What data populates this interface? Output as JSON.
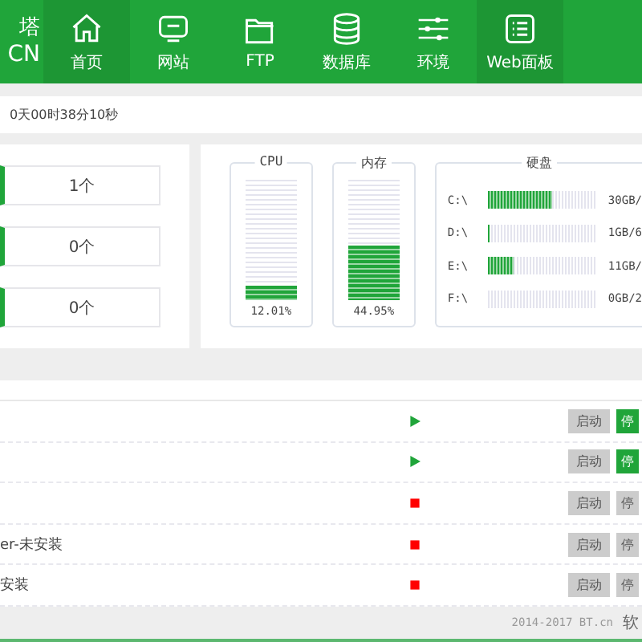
{
  "header": {
    "logo": {
      "line_1": "塔",
      "line_2": "CN"
    },
    "nav": [
      {
        "label": "首页",
        "selected": true
      },
      {
        "label": "网站",
        "selected": false
      },
      {
        "label": "FTP",
        "selected": false
      },
      {
        "label": "数据库",
        "selected": false
      },
      {
        "label": "环境",
        "selected": false
      },
      {
        "label": "Web面板",
        "selected": true
      }
    ]
  },
  "uptime": "0天00时38分10秒",
  "counts": [
    "1个",
    "0个",
    "0个"
  ],
  "gauges": [
    {
      "title": "CPU",
      "level": 0.1201,
      "reading": "12.01%"
    },
    {
      "title": "内存",
      "level": 0.4495,
      "reading": "44.95%"
    }
  ],
  "disk": {
    "title": "硬盘",
    "drives": [
      {
        "name": "C:\\",
        "level": 0.6,
        "reading": "30GB/"
      },
      {
        "name": "D:\\",
        "level": 0.02,
        "reading": "1GB/6"
      },
      {
        "name": "E:\\",
        "level": 0.24,
        "reading": "11GB/"
      },
      {
        "name": "F:\\",
        "level": 0,
        "reading": "0GB/2"
      }
    ]
  },
  "services": [
    {
      "running": true,
      "start": "启动",
      "stop": "停"
    },
    {
      "running": true,
      "start": "启动",
      "stop": "停"
    },
    {
      "running": false,
      "start": "启动",
      "stop": "停"
    },
    {
      "name": "er-未安装",
      "running": false,
      "start": "启动",
      "stop": "停"
    },
    {
      "name": "安装",
      "running": false,
      "start": "启动",
      "stop": "停"
    }
  ],
  "footer": {
    "copyright": "2014-2017 BT.cn",
    "link": "软"
  }
}
